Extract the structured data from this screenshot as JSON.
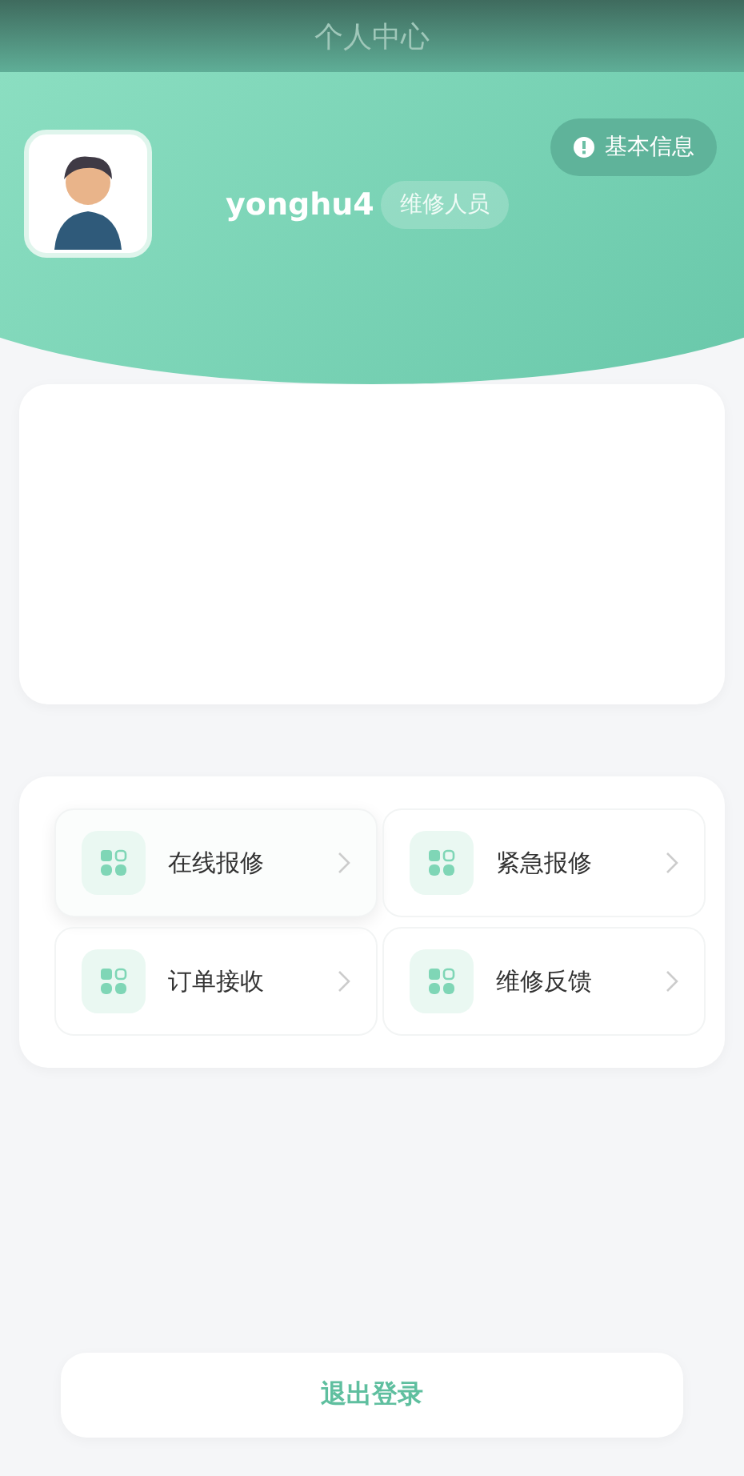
{
  "header": {
    "title": "个人中心"
  },
  "profile": {
    "username": "yonghu4",
    "role": "维修人员",
    "info_button": "基本信息"
  },
  "menu": [
    {
      "label": "在线报修",
      "selected": true
    },
    {
      "label": "紧急报修",
      "selected": false
    },
    {
      "label": "订单接收",
      "selected": false
    },
    {
      "label": "维修反馈",
      "selected": false
    }
  ],
  "logout": "退出登录"
}
